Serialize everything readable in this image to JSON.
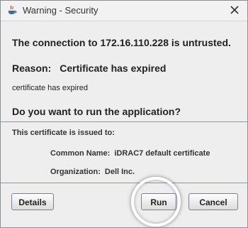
{
  "window": {
    "title": "Warning - Security",
    "close_icon": "close-icon",
    "title_icon": "java-icon"
  },
  "message": {
    "headline": "The connection to 172.16.110.228 is untrusted.",
    "reason_label": "Reason:",
    "reason_value": "Certificate has expired",
    "reason_detail": "certificate has expired",
    "question": "Do you want to run the application?"
  },
  "certificate": {
    "title": "This certificate is issued to:",
    "fields": [
      {
        "key": "Common Name:",
        "value": "iDRAC7 default certificate"
      },
      {
        "key": "Organization:",
        "value": "Dell Inc."
      }
    ]
  },
  "buttons": {
    "details": "Details",
    "run": "Run",
    "cancel": "Cancel"
  },
  "colors": {
    "separator": "#8c96b4",
    "background": "#eeeeee",
    "highlight_ring": "#ffffff"
  }
}
